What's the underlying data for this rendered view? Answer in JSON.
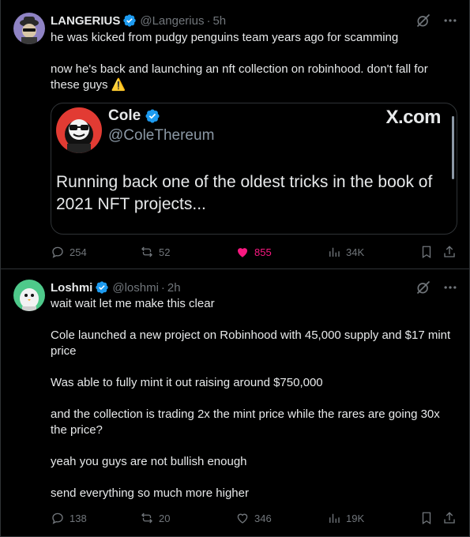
{
  "posts": [
    {
      "name": "LANGERIUS",
      "handle": "@Langerius",
      "time": "5h",
      "paragraphs": [
        "he was kicked from pudgy penguins team years ago for scamming",
        "now he's back and launching an nft collection on robinhood. don't fall for these guys ⚠️"
      ],
      "quote": {
        "name": "Cole",
        "handle": "@ColeThereum",
        "logo": "X.com",
        "text": "Running back one of the oldest tricks in the book of 2021 NFT projects..."
      },
      "replies": "254",
      "reposts": "52",
      "likes": "855",
      "views": "34K"
    },
    {
      "name": "Loshmi",
      "handle": "@loshmi",
      "time": "2h",
      "paragraphs": [
        "wait wait let me make this clear",
        "Cole launched a new project on Robinhood with 45,000 supply and $17 mint price",
        "Was able to fully mint it out raising around $750,000",
        "and the collection is trading 2x the mint price while the rares are going 30x the price?",
        "yeah you guys are not bullish enough",
        "send everything so much more higher"
      ],
      "replies": "138",
      "reposts": "20",
      "likes": "346",
      "views": "19K"
    }
  ],
  "separator": "·",
  "colors": {
    "background": "#000000",
    "text": "#e7e9ea",
    "muted": "#71767b",
    "verified": "#1d9bf0",
    "like": "#f91880",
    "border": "#2f3336"
  }
}
